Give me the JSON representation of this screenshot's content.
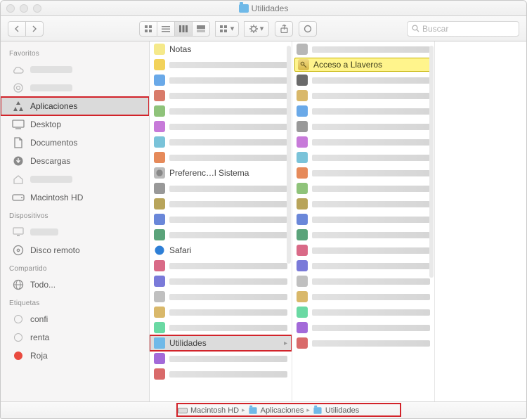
{
  "window": {
    "title": "Utilidades"
  },
  "toolbar": {
    "search_placeholder": "Buscar"
  },
  "sidebar": {
    "sections": {
      "favorites": "Favoritos",
      "devices": "Dispositivos",
      "shared": "Compartido",
      "tags": "Etiquetas"
    },
    "favorites": [
      {
        "label": "",
        "blurred": true,
        "icon": "icloud-icon"
      },
      {
        "label": "",
        "blurred": true,
        "icon": "airdrop-icon"
      },
      {
        "label": "Aplicaciones",
        "icon": "applications-icon",
        "selected": true,
        "highlight": true
      },
      {
        "label": "Desktop",
        "icon": "desktop-icon"
      },
      {
        "label": "Documentos",
        "icon": "documents-icon"
      },
      {
        "label": "Descargas",
        "icon": "downloads-icon"
      },
      {
        "label": "",
        "blurred": true,
        "icon": "home-icon"
      },
      {
        "label": "Macintosh HD",
        "icon": "hdd-icon"
      }
    ],
    "devices": [
      {
        "label": "",
        "blurred": true,
        "icon": "imac-icon"
      },
      {
        "label": "Disco remoto",
        "icon": "remote-disc-icon"
      }
    ],
    "shared": [
      {
        "label": "Todo...",
        "icon": "network-icon"
      }
    ],
    "tags": [
      {
        "label": "confi",
        "color": "none"
      },
      {
        "label": "renta",
        "color": "none"
      },
      {
        "label": "Roja",
        "color": "red"
      }
    ]
  },
  "columns": {
    "applications": {
      "visible": [
        {
          "label": "Notas",
          "kind": "app"
        },
        {
          "label": "Preferenc…l Sistema",
          "kind": "app",
          "icon": "gear"
        },
        {
          "label": "Safari",
          "kind": "app",
          "icon": "safari"
        },
        {
          "label": "Utilidades",
          "kind": "folder",
          "selected": true,
          "highlight": true
        }
      ],
      "blurred_rows": 18
    },
    "utilities": {
      "highlighted": {
        "label": "Acceso a Llaveros",
        "icon": "keychain-icon"
      },
      "blurred_rows": 20
    }
  },
  "pathbar": {
    "segments": [
      {
        "label": "Macintosh HD",
        "icon": "hdd-icon"
      },
      {
        "label": "Aplicaciones",
        "icon": "folder-icon"
      },
      {
        "label": "Utilidades",
        "icon": "folder-icon"
      }
    ]
  }
}
